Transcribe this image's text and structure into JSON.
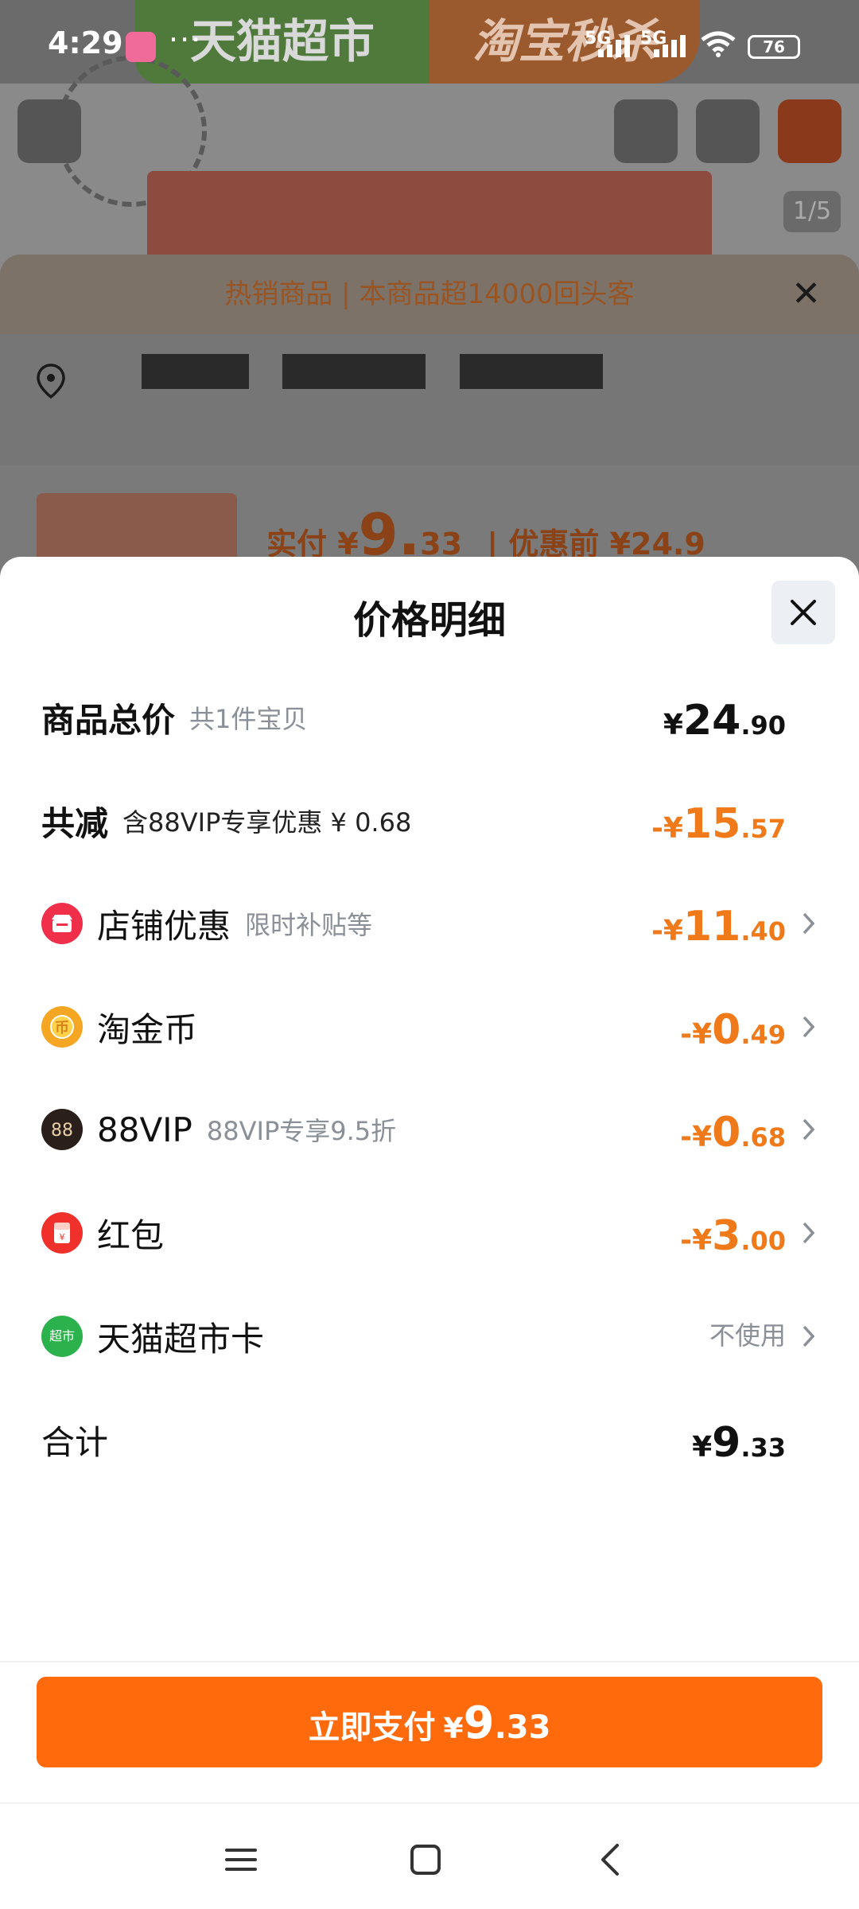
{
  "status_bar": {
    "time": "4:29",
    "dots": "···",
    "signal1": "5G",
    "signal2": "5G",
    "battery": "76"
  },
  "background": {
    "banner_left": "天猫超市",
    "banner_right": "淘宝秒杀",
    "image_counter": "1/5",
    "hot_banner": "热销商品 | 本商品超14000回头客",
    "item_pay_prefix": "实付 ¥",
    "item_pay_int": "9.",
    "item_pay_dec": "33",
    "item_original": "| 优惠前 ¥24.9"
  },
  "sheet": {
    "title": "价格明细",
    "rows": {
      "total": {
        "label": "商品总价",
        "sub": "共1件宝贝",
        "cur": "¥",
        "int": "24",
        "dec": ".90"
      },
      "reduce": {
        "label": "共减",
        "sub": "含88VIP专享优惠 ¥ 0.68",
        "cur": "-¥",
        "int": "15",
        "dec": ".57"
      },
      "shop": {
        "label": "店铺优惠",
        "sub": "限时补贴等",
        "cur": "-¥",
        "int": "11",
        "dec": ".40"
      },
      "coin": {
        "label": "淘金币",
        "cur": "-¥",
        "int": "0",
        "dec": ".49"
      },
      "vip": {
        "label": "88VIP",
        "sub": "88VIP专享9.5折",
        "cur": "-¥",
        "int": "0",
        "dec": ".68"
      },
      "redpack": {
        "label": "红包",
        "cur": "-¥",
        "int": "3",
        "dec": ".00"
      },
      "card": {
        "label": "天猫超市卡",
        "value": "不使用"
      },
      "sum": {
        "label": "合计",
        "cur": "¥",
        "int": "9",
        "dec": ".33"
      }
    },
    "pay_button": {
      "label": "立即支付",
      "cur": "¥",
      "int": "9",
      "dec": ".33"
    }
  },
  "colors": {
    "accent": "#ff6a0d",
    "discount": "#f07a1a",
    "muted": "#8a8f98"
  }
}
